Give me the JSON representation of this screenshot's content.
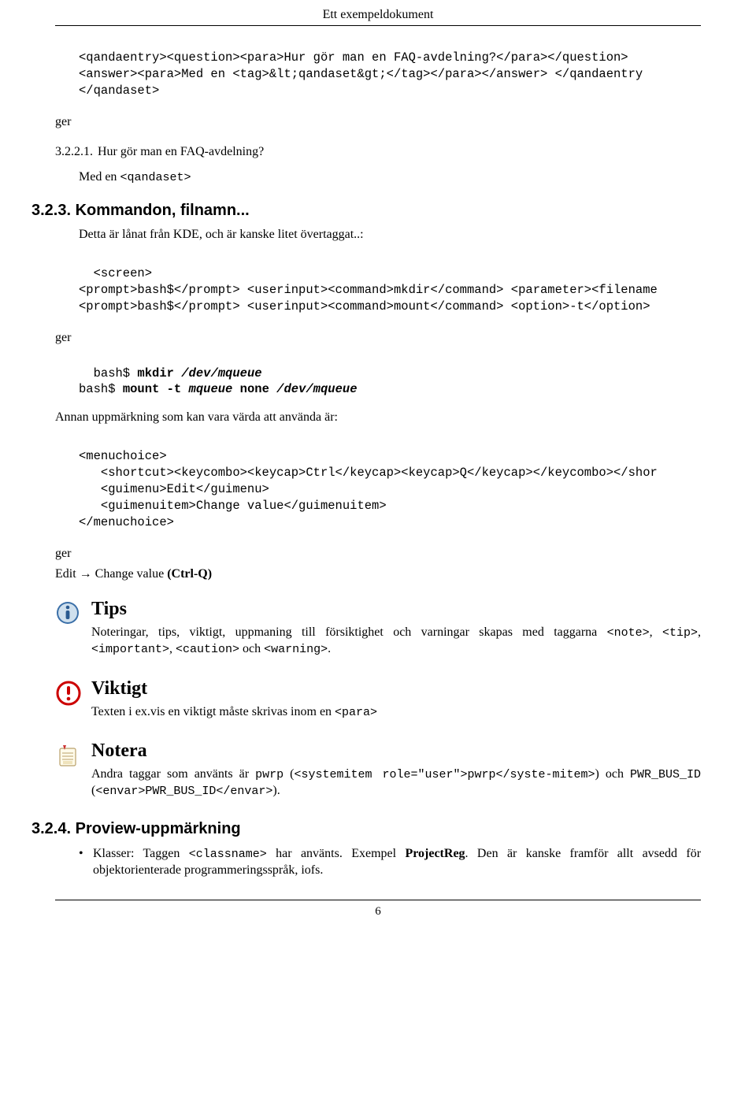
{
  "header": {
    "title": "Ett exempeldokument"
  },
  "codeblock1": {
    "l1": "<qandaentry><question><para>Hur gör man en FAQ-avdelning?</para></question>",
    "l2": "<answer><para>Med en <tag>&lt;qandaset&gt;</tag></para></answer> </qandaentry",
    "l3": "</qandaset>"
  },
  "ger1": "ger",
  "qa": {
    "num": "3.2.2.1.",
    "question": "Hur gör man en FAQ-avdelning?",
    "answer_pre": "Med en ",
    "answer_code": "<qandaset>"
  },
  "h3_1": {
    "num": "3.2.3.",
    "text": "Kommandon, filnamn..."
  },
  "para1": "Detta är lånat från KDE, och är kanske litet övertaggat..:",
  "codeblock2": {
    "l1": "  <screen>",
    "l2": "<prompt>bash$</prompt> <userinput><command>mkdir</command> <parameter><filename",
    "l3": "<prompt>bash$</prompt> <userinput><command>mount</command> <option>-t</option>"
  },
  "ger2": "ger",
  "shell": {
    "p1": "  bash$ ",
    "c1": "mkdir",
    "arg1": " /dev/mqueue",
    "p2": "bash$ ",
    "c2": "mount",
    "opt": " -t",
    "it1": " mqueue",
    "b1": " none",
    "it2": " /dev/mqueue"
  },
  "para2": "Annan uppmärkning som kan vara värda att använda är:",
  "codeblock3": {
    "l1": "<menuchoice>",
    "l2": "   <shortcut><keycombo><keycap>Ctrl</keycap><keycap>Q</keycap></keycombo></shor",
    "l3": "   <guimenu>Edit</guimenu>",
    "l4": "   <guimenuitem>Change value</guimenuitem>",
    "l5": "</menuchoice>"
  },
  "ger3": "ger",
  "menu": {
    "m1": "Edit",
    "arrow": " → ",
    "m2": "Change value",
    "keycombo": " (Ctrl-Q)"
  },
  "tips": {
    "title": "Tips",
    "p1a": "Noteringar, tips, viktigt, uppmaning till försiktighet och varningar skapas med taggarna ",
    "c1": "<note>",
    "s1": ", ",
    "c2": "<tip>",
    "s2": ", ",
    "c3": "<important>",
    "s3": ", ",
    "c4": "<caution>",
    "s4": " och ",
    "c5": "<warning>",
    "s5": "."
  },
  "viktigt": {
    "title": "Viktigt",
    "p1a": "Texten i ex.vis en viktigt måste skrivas inom en ",
    "c1": "<para>"
  },
  "notera": {
    "title": "Notera",
    "p1a": "Andra taggar som använts är ",
    "c1": "pwrp",
    "s1": " (",
    "c2": "<systemitem role=\"user\">pwrp</syste-mitem>",
    "s2": ") och ",
    "c3": "PWR_BUS_ID",
    "s3": " (",
    "c4": "<envar>PWR_BUS_ID</envar>",
    "s4": ")."
  },
  "h3_2": {
    "num": "3.2.4.",
    "text": "Proview-uppmärkning"
  },
  "bullet1": {
    "t1": "Klasser: Taggen ",
    "c1": "<classname>",
    "t2": " har använts. Exempel ",
    "b1": "ProjectReg",
    "t3": ". Den är kanske framför allt avsedd för objektorienterade programmeringsspråk, iofs."
  },
  "page_number": "6"
}
